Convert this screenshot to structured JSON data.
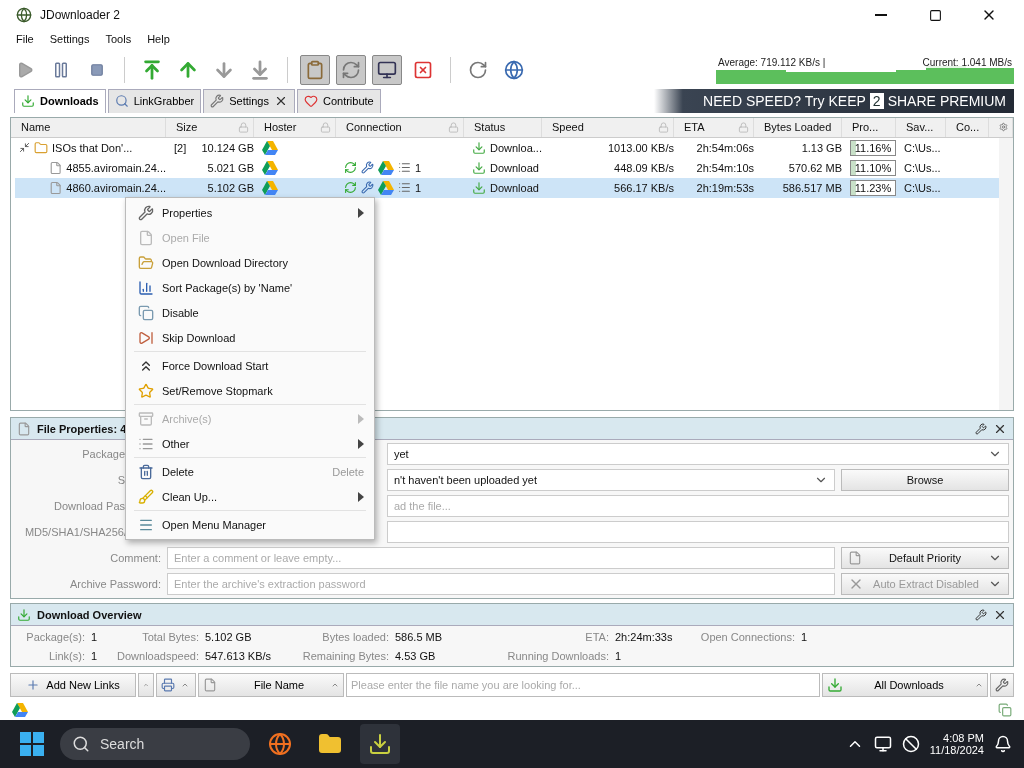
{
  "window": {
    "title": "JDownloader 2"
  },
  "menu_bar": [
    "File",
    "Settings",
    "Tools",
    "Help"
  ],
  "speed_graph": {
    "average": "Average: 719.112 KB/s |",
    "current": "Current: 1.041 MB/s"
  },
  "tabs": [
    {
      "label": "Downloads",
      "selected": true,
      "closable": false
    },
    {
      "label": "LinkGrabber",
      "selected": false,
      "closable": false
    },
    {
      "label": "Settings",
      "selected": false,
      "closable": true
    },
    {
      "label": "Contribute",
      "selected": false,
      "closable": false
    }
  ],
  "banner": {
    "prefix": "NEED SPEED? Try",
    "brand_1": "KEEP",
    "brand_2": "2",
    "brand_3": "SHARE",
    "suffix": "PREMIUM"
  },
  "table": {
    "columns": [
      {
        "label": "Name",
        "locked": false
      },
      {
        "label": "Size",
        "locked": true
      },
      {
        "label": "Hoster",
        "locked": true
      },
      {
        "label": "Connection",
        "locked": true
      },
      {
        "label": "Status",
        "locked": false
      },
      {
        "label": "Speed",
        "locked": true
      },
      {
        "label": "ETA",
        "locked": true
      },
      {
        "label": "Bytes Loaded",
        "locked": false
      },
      {
        "label": "Pro...",
        "locked": false
      },
      {
        "label": "Sav...",
        "locked": false
      },
      {
        "label": "Co...",
        "locked": false
      }
    ],
    "rows": [
      {
        "kind": "package",
        "expanded": true,
        "selected": false,
        "name": "ISOs that Don'...",
        "count": "[2]",
        "size": "10.124 GB",
        "status": "Downloa...",
        "speed": "1013.00 KB/s",
        "eta": "2h:54m:06s",
        "loaded": "1.13 GB",
        "progress": "11.16%",
        "level": 0.1116,
        "save_to": "C:\\Us..."
      },
      {
        "kind": "file",
        "selected": false,
        "name": "4855.aviromain.24...",
        "size": "5.021 GB",
        "connections": "1",
        "status": "Download",
        "speed": "448.09 KB/s",
        "eta": "2h:54m:10s",
        "loaded": "570.62 MB",
        "progress": "11.10%",
        "level": 0.111,
        "save_to": "C:\\Us..."
      },
      {
        "kind": "file",
        "selected": true,
        "name": "4860.aviromain.24...",
        "size": "5.102 GB",
        "connections": "1",
        "status": "Download",
        "speed": "566.17 KB/s",
        "eta": "2h:19m:53s",
        "loaded": "586.517 MB",
        "progress": "11.23%",
        "level": 0.1123,
        "save_to": "C:\\Us..."
      }
    ]
  },
  "context_menu": {
    "groups": [
      [
        {
          "label": "Properties",
          "disabled": false,
          "submenu": true
        },
        {
          "label": "Open File",
          "disabled": true,
          "submenu": false
        },
        {
          "label": "Open Download Directory",
          "disabled": false,
          "submenu": false
        },
        {
          "label": "Sort Package(s) by 'Name'",
          "disabled": false,
          "submenu": false
        },
        {
          "label": "Disable",
          "disabled": false,
          "submenu": false
        },
        {
          "label": "Skip Download",
          "disabled": false,
          "submenu": false
        }
      ],
      [
        {
          "label": "Force Download Start",
          "disabled": false,
          "submenu": false
        },
        {
          "label": "Set/Remove Stopmark",
          "disabled": false,
          "submenu": false
        }
      ],
      [
        {
          "label": "Archive(s)",
          "disabled": true,
          "submenu": true
        },
        {
          "label": "Other",
          "disabled": false,
          "submenu": true
        }
      ],
      [
        {
          "label": "Delete",
          "disabled": false,
          "submenu": false,
          "shortcut": "Delete"
        },
        {
          "label": "Clean Up...",
          "disabled": false,
          "submenu": true
        }
      ],
      [
        {
          "label": "Open Menu Manager",
          "disabled": false,
          "submenu": false
        }
      ]
    ]
  },
  "file_properties": {
    "title": "File Properties: 4",
    "package": {
      "label": "Package",
      "value": "yet"
    },
    "save_to": {
      "label": "S",
      "value": "n't haven't been uploaded yet",
      "button": "Browse"
    },
    "download_password": {
      "label": "Download Pas",
      "placeholder": "ad the file..."
    },
    "checksum": {
      "label": "MD5/SHA1/SHA256/"
    },
    "comment": {
      "label": "Comment:",
      "placeholder": "Enter a comment or leave empty...",
      "priority": "Default Priority"
    },
    "archive_password": {
      "label": "Archive Password:",
      "placeholder": "Enter the archive's extraction password",
      "extract": "Auto Extract Disabled",
      "extract_disabled": true
    }
  },
  "download_overview": {
    "title": "Download Overview",
    "stats": [
      [
        {
          "label": "Package(s):",
          "value": "1"
        },
        {
          "label": "Total Bytes:",
          "value": "5.102 GB"
        },
        {
          "label": "Bytes loaded:",
          "value": "586.5 MB"
        },
        {
          "label": "ETA:",
          "value": "2h:24m:33s"
        },
        {
          "label": "Open Connections:",
          "value": "1"
        }
      ],
      [
        {
          "label": "Link(s):",
          "value": "1"
        },
        {
          "label": "Downloadspeed:",
          "value": "547.613 KB/s"
        },
        {
          "label": "Remaining Bytes:",
          "value": "4.53 GB"
        },
        {
          "label": "Running Downloads:",
          "value": "1"
        }
      ]
    ]
  },
  "bottom_bar": {
    "add_links": "Add New Links",
    "search_column": "File Name",
    "search_placeholder": "Please enter the file name you are looking for...",
    "filter": "All Downloads"
  },
  "taskbar": {
    "search": "Search",
    "time": "4:08 PM",
    "date": "11/18/2024"
  }
}
